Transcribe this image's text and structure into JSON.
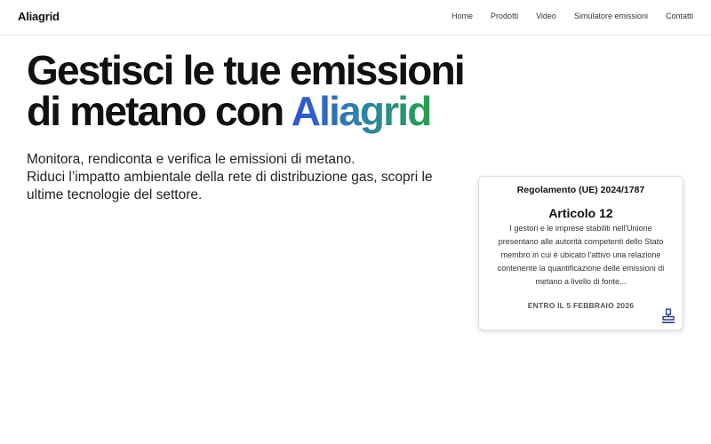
{
  "brand": "Aliagrid",
  "nav": {
    "home": "Home",
    "products": "Prodotti",
    "video": "Video",
    "simulator": "Simulatore emissioni",
    "contacts": "Contatti"
  },
  "hero": {
    "title_line1": "Gestisci le tue emissioni",
    "title_line2_prefix": "di metano con ",
    "title_accent": "Aliagrid",
    "subtitle_line1": "Monitora, rendiconta e verifica le emissioni di metano.",
    "subtitle_line2": "Riduci l’impatto ambientale della rete di distribuzione gas, scopri le ultime tecnologie del settore."
  },
  "card": {
    "regulation": "Regolamento (UE) 2024/1787",
    "article": "Articolo 12",
    "body": "I gestori e le imprese stabiliti nell'Unione presentano alle autorità competenti dello Stato membro in cui è ubicato l'attivo una relazione contenente la quantificazione delle emissioni di metano a livello di fonte...",
    "deadline": "ENTRO IL 5 FEBBRAIO 2026",
    "icon": "stamp-icon",
    "icon_color": "#2b3a8c"
  },
  "colors": {
    "accent_start": "#2f52d6",
    "accent_end": "#25a04d"
  }
}
